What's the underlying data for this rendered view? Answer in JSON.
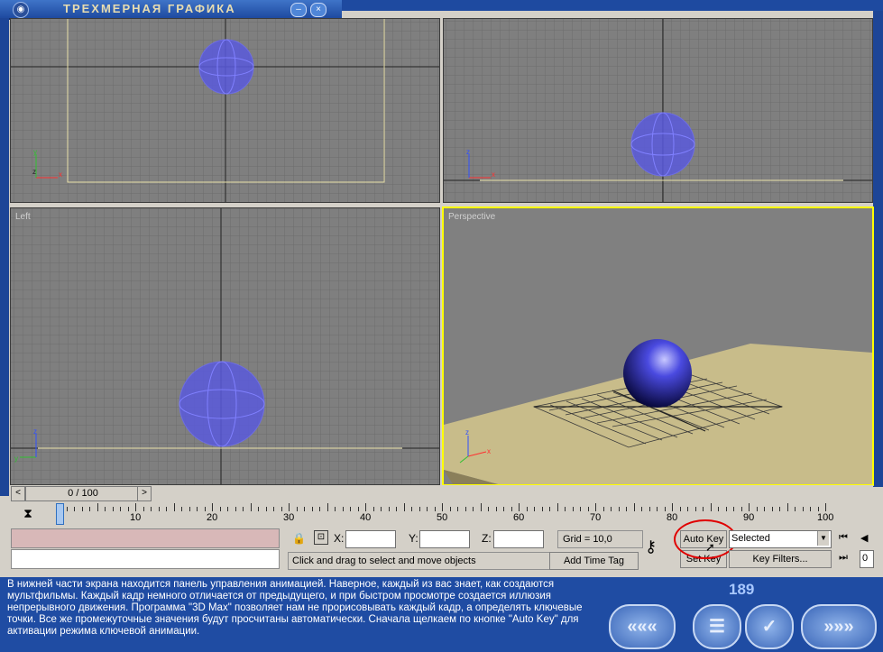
{
  "window": {
    "title": "ТРЕХМЕРНАЯ ГРАФИКА",
    "app_icon": "globe-icon",
    "minimize_icon": "minimize-icon",
    "close_icon": "close-icon"
  },
  "viewports": {
    "top": {
      "label": ""
    },
    "front": {
      "label": ""
    },
    "left": {
      "label": "Left"
    },
    "perspective": {
      "label": "Perspective"
    }
  },
  "time_slider": {
    "value": "0 / 100",
    "prev_icon": "chevron-left-icon",
    "next_icon": "chevron-right-icon"
  },
  "timeline": {
    "ticks": [
      "0",
      "10",
      "20",
      "30",
      "40",
      "50",
      "60",
      "70",
      "80",
      "90",
      "100"
    ],
    "icon": "timeline-config-icon"
  },
  "coords": {
    "lock_icon": "lock-icon",
    "select_icon": "absolute-mode-icon",
    "x_label": "X:",
    "y_label": "Y:",
    "z_label": "Z:",
    "x_value": "",
    "y_value": "",
    "z_value": "",
    "grid": "Grid = 10,0",
    "status": "Click and drag to select and move objects",
    "add_time_tag": "Add Time Tag"
  },
  "animation": {
    "key_icon": "key-icon",
    "auto_key": "Auto Key",
    "set_key": "Set Key",
    "selected": "Selected",
    "key_filters": "Key Filters...",
    "go_start_icon": "go-to-start-icon",
    "prev_frame_icon": "prev-frame-icon",
    "frame_field_icon": "key-mode-icon",
    "frame_value": "0"
  },
  "footer": {
    "description": "В нижней части экрана находится панель управления анимацией. Наверное, каждый из вас знает, как создаются мультфильмы. Каждый кадр немного отличается от предыдущего, и при быстром просмотре создается иллюзия непрерывного движения. Программа \"3D Max\" позволяет нам не прорисовывать каждый кадр, а определять ключевые точки. Все же промежуточные значения будут просчитаны автоматически. Сначала щелкаем по кнопке \"Auto Key\" для активации режима ключевой анимации.",
    "page_number": "189",
    "rewind_label": "«««",
    "menu_label": "☰",
    "check_label": "✓",
    "forward_label": "»»»"
  },
  "colors": {
    "frame_blue": "#1f4ca3",
    "viewport_gray": "#7f7f7f",
    "active_viewport": "#ffff00",
    "highlight_red": "#e00000",
    "sphere_blue": "#4a4ae0"
  }
}
